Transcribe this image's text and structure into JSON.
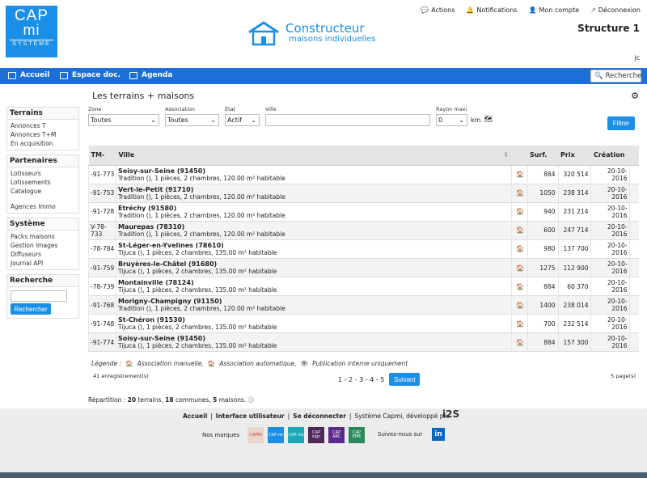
{
  "logo": {
    "line1": "CAP",
    "line2": "mi",
    "line3": "SYSTÈME"
  },
  "brand": {
    "title": "Constructeur",
    "subtitle": "maisons individuelles"
  },
  "topnav": {
    "actions": "Actions",
    "notifications": "Notifications",
    "account": "Mon compte",
    "logout": "Déconnexion"
  },
  "structure": "Structure 1",
  "user_initials": "jc",
  "menu": {
    "home": "Accueil",
    "docs": "Espace doc.",
    "agenda": "Agenda",
    "search": "Recherche"
  },
  "sidebar": {
    "terrains": {
      "title": "Terrains",
      "items": [
        "Annonces T",
        "Annonces T+M",
        "En acquisition"
      ]
    },
    "partenaires": {
      "title": "Partenaires",
      "items": [
        "Lotisseurs",
        "Lotissements",
        "Catalogue",
        "Agences Immo"
      ]
    },
    "systeme": {
      "title": "Système",
      "items": [
        "Packs maisons",
        "Gestion images",
        "Diffuseurs",
        "Journal API"
      ]
    },
    "recherche": {
      "title": "Recherche",
      "button": "Rechercher"
    }
  },
  "page_title": "Les terrains + maisons",
  "filters": {
    "zone_label": "Zone",
    "zone_value": "Toutes",
    "assoc_label": "Association",
    "assoc_value": "Toutes",
    "etat_label": "État",
    "etat_value": "Actif",
    "ville_label": "Ville",
    "ville_value": "",
    "rayon_label": "Rayon maxi",
    "rayon_value": "0",
    "rayon_unit": "km",
    "button": "Filtrer"
  },
  "table": {
    "headers": {
      "tm": "TM-",
      "ville": "Ville",
      "surf": "Surf.",
      "prix": "Prix",
      "creation": "Création"
    },
    "rows": [
      {
        "tm": "-91-773",
        "city": "Soisy-sur-Seine (91450)",
        "desc": "Tradition (), 1 pièces, 2 chambres, 120.00 m² habitable",
        "surf": "884",
        "prix": "320 514",
        "date": "20-10-2016"
      },
      {
        "tm": "-91-753",
        "city": "Vert-le-Petit (91710)",
        "desc": "Tradition (), 1 pièces, 2 chambres, 120.00 m² habitable",
        "surf": "1050",
        "prix": "238 314",
        "date": "20-10-2016"
      },
      {
        "tm": "-91-728",
        "city": "Etréchy (91580)",
        "desc": "Tradition (), 1 pièces, 2 chambres, 120.00 m² habitable",
        "surf": "940",
        "prix": "231 214",
        "date": "20-10-2016"
      },
      {
        "tm": "V-78-733",
        "city": "Maurepas (78310)",
        "desc": "Tradition (), 1 pièces, 2 chambres, 120.00 m² habitable",
        "surf": "600",
        "prix": "247 714",
        "date": "20-10-2016"
      },
      {
        "tm": "-78-784",
        "city": "St-Léger-en-Yvelines (78610)",
        "desc": "Tijuca (), 1 pièces, 2 chambres, 135.00 m² habitable",
        "surf": "980",
        "prix": "137 700",
        "date": "20-10-2016"
      },
      {
        "tm": "-91-759",
        "city": "Bruyères-le-Châtel (91680)",
        "desc": "Tijuca (), 1 pièces, 2 chambres, 135.00 m² habitable",
        "surf": "1275",
        "prix": "112 900",
        "date": "20-10-2016"
      },
      {
        "tm": "-78-739",
        "city": "Montainville (78124)",
        "desc": "Tijuca (), 1 pièces, 2 chambres, 135.00 m² habitable",
        "surf": "884",
        "prix": "60 370",
        "date": "20-10-2016"
      },
      {
        "tm": "-91-768",
        "city": "Morigny-Champigny (91150)",
        "desc": "Tradition (), 1 pièces, 2 chambres, 120.00 m² habitable",
        "surf": "1400",
        "prix": "238 014",
        "date": "20-10-2016"
      },
      {
        "tm": "-91-748",
        "city": "St-Chéron (91530)",
        "desc": "Tijuca (), 1 pièces, 2 chambres, 135.00 m² habitable",
        "surf": "700",
        "prix": "232 514",
        "date": "20-10-2016"
      },
      {
        "tm": "-91-774",
        "city": "Soisy-sur-Seine (91450)",
        "desc": "Tijuca (), 1 pièces, 2 chambres, 135.00 m² habitable",
        "surf": "884",
        "prix": "157 300",
        "date": "20-10-2016"
      }
    ]
  },
  "legend": {
    "label": "Légende :",
    "manual": "Association manuelle,",
    "auto": "Association automatique,",
    "internal": "Publication interne uniquement"
  },
  "pagination": {
    "count": "41 enregistrement(s)",
    "pages": "1 - 2 - 3 - 4 - 5",
    "next": "Suivant",
    "total_pages": "5 page(s)"
  },
  "repartition": {
    "prefix": "Répartition : ",
    "terrains": "20",
    "t1": " terrains, ",
    "communes": "18",
    "t2": " communes, ",
    "maisons": "5",
    "t3": " maisons."
  },
  "footer": {
    "home": "Accueil",
    "ui": "Interface utilisateur",
    "logout": "Se déconnecter",
    "credit": "Système Capmi, développé par",
    "i2s": "i2S",
    "marques": "Nos marques",
    "follow": "Suivez-nous sur",
    "linkedin": "in",
    "brands": [
      {
        "label": "CAPMI",
        "color": "#e8d6cc",
        "text": "#c44"
      },
      {
        "label": "CAP mi",
        "color": "#1b8fe6",
        "text": "#fff"
      },
      {
        "label": "CAP ms",
        "color": "#1aa8b8",
        "text": "#fff"
      },
      {
        "label": "CAP sign",
        "color": "#4b2a5a",
        "text": "#fff"
      },
      {
        "label": "CAP ARC",
        "color": "#5c2a8a",
        "text": "#fff"
      },
      {
        "label": "CAP EME",
        "color": "#2a8a5a",
        "text": "#fff"
      }
    ]
  },
  "colors": {
    "primary": "#1b8fe6",
    "menubar": "#1b6fd6",
    "manual_icon": "#2a8a2a"
  }
}
